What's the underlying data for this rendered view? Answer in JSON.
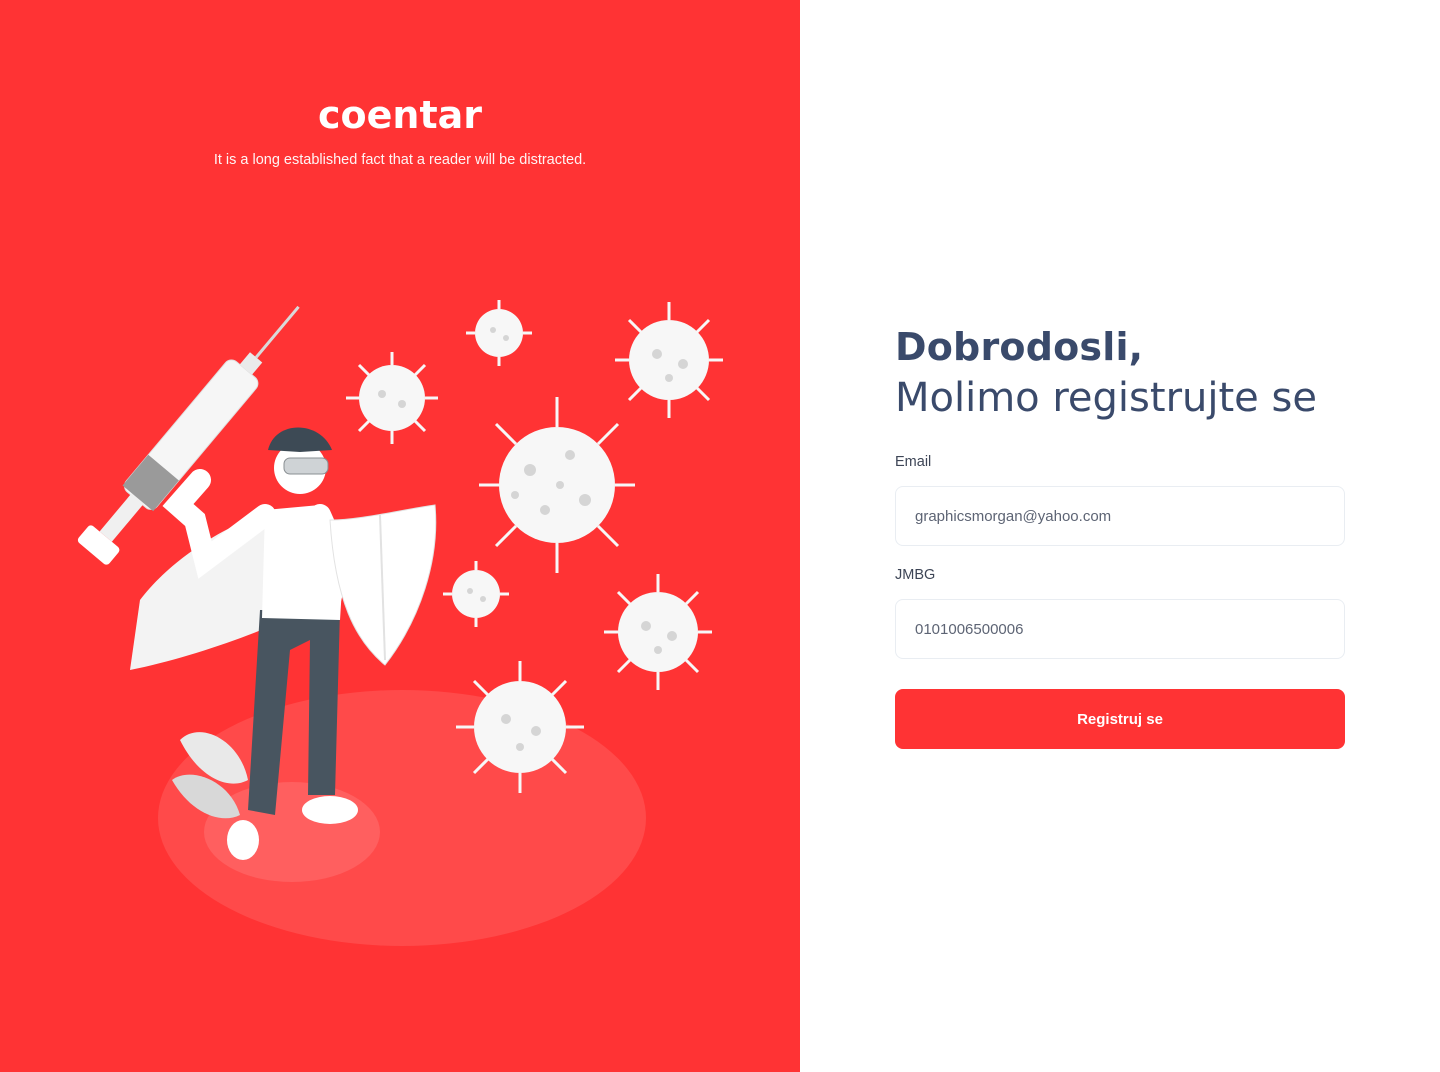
{
  "brand": {
    "logo_text": "coentar",
    "tagline": "It is a long established fact that a reader will be distracted."
  },
  "illustration": {
    "subject": "doctor-with-syringe-and-shield-fighting-virus"
  },
  "form": {
    "greeting": "Dobrodosli,",
    "subtitle": "Molimo registrujte se",
    "email_label": "Email",
    "email_value": "graphicsmorgan@yahoo.com",
    "jmbg_label": "JMBG",
    "jmbg_value": "0101006500006",
    "submit_label": "Registruj se"
  },
  "colors": {
    "brand_red": "#ff3334",
    "heading_navy": "#3a4a6b",
    "input_border": "#e9edf2"
  }
}
